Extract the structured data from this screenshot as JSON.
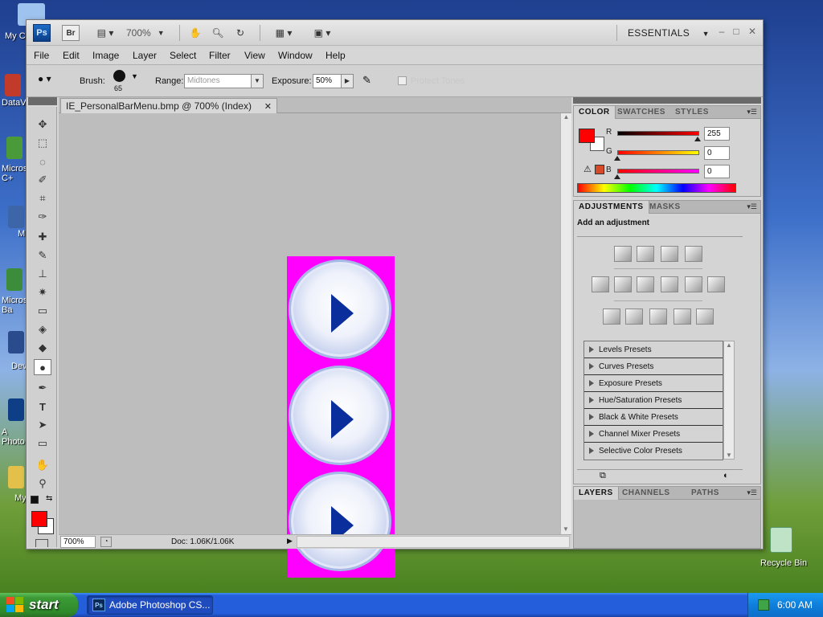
{
  "desktop": {
    "icons": [
      {
        "label": "My C"
      },
      {
        "label": "DataV"
      },
      {
        "label": "Micros C+"
      },
      {
        "label": "M"
      },
      {
        "label": "Micros Ba"
      },
      {
        "label": "Dev"
      },
      {
        "label": "A Photo"
      },
      {
        "label": "My"
      }
    ],
    "recycle_bin": "Recycle Bin"
  },
  "taskbar": {
    "start_label": "start",
    "task_label": "Adobe Photoshop CS...",
    "clock": "6:00 AM"
  },
  "app": {
    "logo": "Ps",
    "bridge": "Br",
    "zoom_level": "700%",
    "workspace": "ESSENTIALS"
  },
  "menu": [
    "File",
    "Edit",
    "Image",
    "Layer",
    "Select",
    "Filter",
    "View",
    "Window",
    "Help"
  ],
  "options": {
    "brush_label": "Brush:",
    "brush_size": "65",
    "range_label": "Range:",
    "range_value": "Midtones",
    "exposure_label": "Exposure:",
    "exposure_value": "50%",
    "protect_tones": "Protect Tones"
  },
  "document": {
    "tab_title": "IE_PersonalBarMenu.bmp @ 700% (Index)",
    "status_zoom": "700%",
    "doc_info": "Doc: 1.06K/1.06K"
  },
  "color_panel": {
    "tabs": [
      "COLOR",
      "SWATCHES",
      "STYLES"
    ],
    "sliders": [
      {
        "letter": "R",
        "value": "255",
        "level": 1.0
      },
      {
        "letter": "G",
        "value": "0",
        "level": 0.0
      },
      {
        "letter": "B",
        "value": "0",
        "level": 0.0
      }
    ],
    "foreground": "#ff0000"
  },
  "adjustments_panel": {
    "tabs": [
      "ADJUSTMENTS",
      "MASKS"
    ],
    "heading": "Add an adjustment",
    "presets": [
      "Levels Presets",
      "Curves Presets",
      "Exposure Presets",
      "Hue/Saturation Presets",
      "Black & White Presets",
      "Channel Mixer Presets",
      "Selective Color Presets"
    ]
  },
  "layers_panel": {
    "tabs": [
      "LAYERS",
      "CHANNELS",
      "PATHS"
    ]
  },
  "colors": {
    "magenta": "#ff00ff",
    "arrow_blue": "#0a2f9c",
    "fg_red": "#ff0000"
  }
}
